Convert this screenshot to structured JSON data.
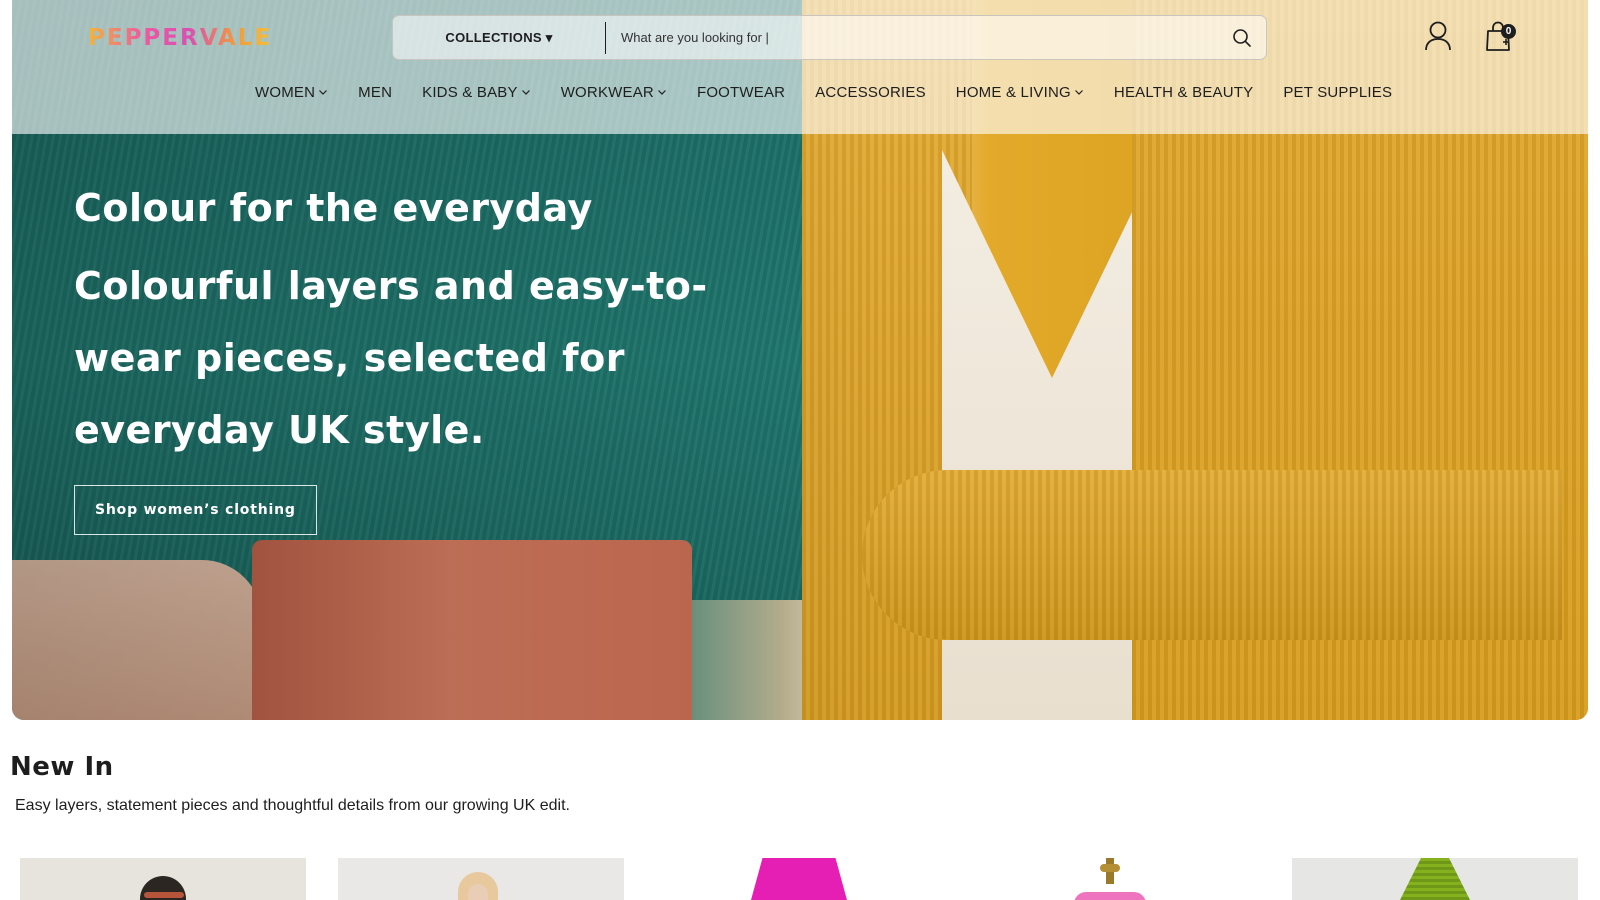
{
  "brand": {
    "logo_text": "PEPPERVALE"
  },
  "search": {
    "collections_label": "COLLECTIONS ▾",
    "placeholder": "What are you looking for |"
  },
  "cart": {
    "count": "0"
  },
  "nav": {
    "items": [
      {
        "label": "WOMEN",
        "has_dropdown": true
      },
      {
        "label": "MEN",
        "has_dropdown": false
      },
      {
        "label": "KIDS & BABY",
        "has_dropdown": true
      },
      {
        "label": "WORKWEAR",
        "has_dropdown": true
      },
      {
        "label": "FOOTWEAR",
        "has_dropdown": false
      },
      {
        "label": "ACCESSORIES",
        "has_dropdown": false
      },
      {
        "label": "HOME & LIVING",
        "has_dropdown": true
      },
      {
        "label": "HEALTH & BEAUTY",
        "has_dropdown": false
      },
      {
        "label": "PET SUPPLIES",
        "has_dropdown": false
      }
    ]
  },
  "hero": {
    "eyebrow": "Colour for the everyday",
    "title": "Colourful layers and easy-to-wear pieces, selected for everyday UK style.",
    "button_label": "Shop women’s clothing"
  },
  "new_in": {
    "title": "New In",
    "subtitle": "Easy layers, statement pieces and thoughtful details from our growing UK edit."
  },
  "colors": {
    "text": "#1e1e1e",
    "hero_green": "#1f786f",
    "hero_mustard": "#d89c1d",
    "product_pink": "#e61fb4",
    "product_olive": "#7fa61a"
  }
}
